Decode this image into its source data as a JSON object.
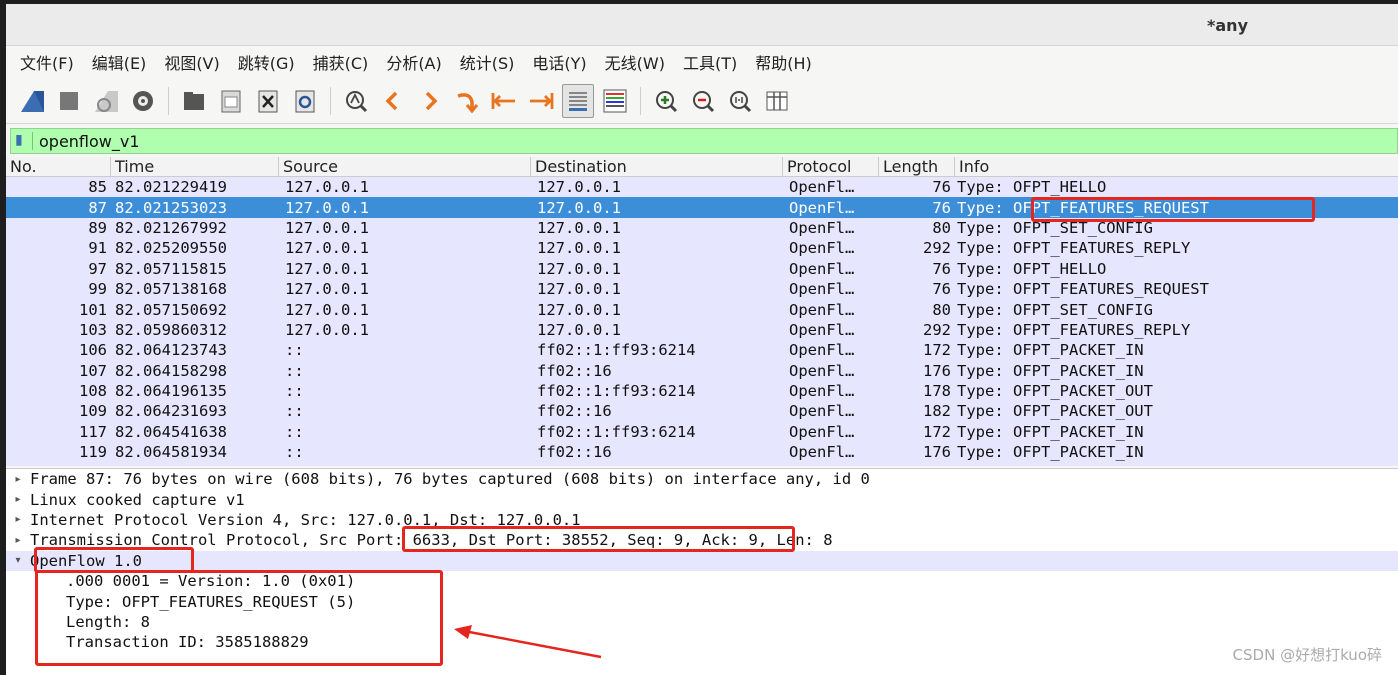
{
  "window": {
    "title": "*any"
  },
  "menu": [
    "文件(F)",
    "编辑(E)",
    "视图(V)",
    "跳转(G)",
    "捕获(C)",
    "分析(A)",
    "统计(S)",
    "电话(Y)",
    "无线(W)",
    "工具(T)",
    "帮助(H)"
  ],
  "filter": {
    "value": "openflow_v1"
  },
  "columns": [
    "No.",
    "Time",
    "Source",
    "Destination",
    "Protocol",
    "Length",
    "Info"
  ],
  "packets": [
    {
      "no": "85",
      "time": "82.021229419",
      "src": "127.0.0.1",
      "dst": "127.0.0.1",
      "proto": "OpenFl…",
      "len": "76",
      "info": "Type: OFPT_HELLO"
    },
    {
      "no": "87",
      "time": "82.021253023",
      "src": "127.0.0.1",
      "dst": "127.0.0.1",
      "proto": "OpenFl…",
      "len": "76",
      "info": "Type: OFPT_FEATURES_REQUEST"
    },
    {
      "no": "89",
      "time": "82.021267992",
      "src": "127.0.0.1",
      "dst": "127.0.0.1",
      "proto": "OpenFl…",
      "len": "80",
      "info": "Type: OFPT_SET_CONFIG"
    },
    {
      "no": "91",
      "time": "82.025209550",
      "src": "127.0.0.1",
      "dst": "127.0.0.1",
      "proto": "OpenFl…",
      "len": "292",
      "info": "Type: OFPT_FEATURES_REPLY"
    },
    {
      "no": "97",
      "time": "82.057115815",
      "src": "127.0.0.1",
      "dst": "127.0.0.1",
      "proto": "OpenFl…",
      "len": "76",
      "info": "Type: OFPT_HELLO"
    },
    {
      "no": "99",
      "time": "82.057138168",
      "src": "127.0.0.1",
      "dst": "127.0.0.1",
      "proto": "OpenFl…",
      "len": "76",
      "info": "Type: OFPT_FEATURES_REQUEST"
    },
    {
      "no": "101",
      "time": "82.057150692",
      "src": "127.0.0.1",
      "dst": "127.0.0.1",
      "proto": "OpenFl…",
      "len": "80",
      "info": "Type: OFPT_SET_CONFIG"
    },
    {
      "no": "103",
      "time": "82.059860312",
      "src": "127.0.0.1",
      "dst": "127.0.0.1",
      "proto": "OpenFl…",
      "len": "292",
      "info": "Type: OFPT_FEATURES_REPLY"
    },
    {
      "no": "106",
      "time": "82.064123743",
      "src": "::",
      "dst": "ff02::1:ff93:6214",
      "proto": "OpenFl…",
      "len": "172",
      "info": "Type: OFPT_PACKET_IN"
    },
    {
      "no": "107",
      "time": "82.064158298",
      "src": "::",
      "dst": "ff02::16",
      "proto": "OpenFl…",
      "len": "176",
      "info": "Type: OFPT_PACKET_IN"
    },
    {
      "no": "108",
      "time": "82.064196135",
      "src": "::",
      "dst": "ff02::1:ff93:6214",
      "proto": "OpenFl…",
      "len": "178",
      "info": "Type: OFPT_PACKET_OUT"
    },
    {
      "no": "109",
      "time": "82.064231693",
      "src": "::",
      "dst": "ff02::16",
      "proto": "OpenFl…",
      "len": "182",
      "info": "Type: OFPT_PACKET_OUT"
    },
    {
      "no": "117",
      "time": "82.064541638",
      "src": "::",
      "dst": "ff02::1:ff93:6214",
      "proto": "OpenFl…",
      "len": "172",
      "info": "Type: OFPT_PACKET_IN"
    },
    {
      "no": "119",
      "time": "82.064581934",
      "src": "::",
      "dst": "ff02::16",
      "proto": "OpenFl…",
      "len": "176",
      "info": "Type: OFPT_PACKET_IN"
    }
  ],
  "selected_row": 1,
  "details": [
    {
      "text": "Frame 87: 76 bytes on wire (608 bits), 76 bytes captured (608 bits) on interface any, id 0",
      "expanded": false
    },
    {
      "text": "Linux cooked capture v1",
      "expanded": false
    },
    {
      "text": "Internet Protocol Version 4, Src: 127.0.0.1, Dst: 127.0.0.1",
      "expanded": false
    },
    {
      "text": "Transmission Control Protocol, Src Port: 6633, Dst Port: 38552, Seq: 9, Ack: 9, Len: 8",
      "expanded": false
    },
    {
      "text": "OpenFlow 1.0",
      "expanded": true
    }
  ],
  "openflow_fields": [
    ".000 0001 = Version: 1.0 (0x01)",
    "Type: OFPT_FEATURES_REQUEST (5)",
    "Length: 8",
    "Transaction ID: 3585188829"
  ],
  "watermark": "CSDN @好想打kuo碎",
  "colors": {
    "selected": "#3d8ed8",
    "list_bg": "#e7e6ff",
    "filter_bg": "#afffaf",
    "annotation": "#e5261f"
  }
}
